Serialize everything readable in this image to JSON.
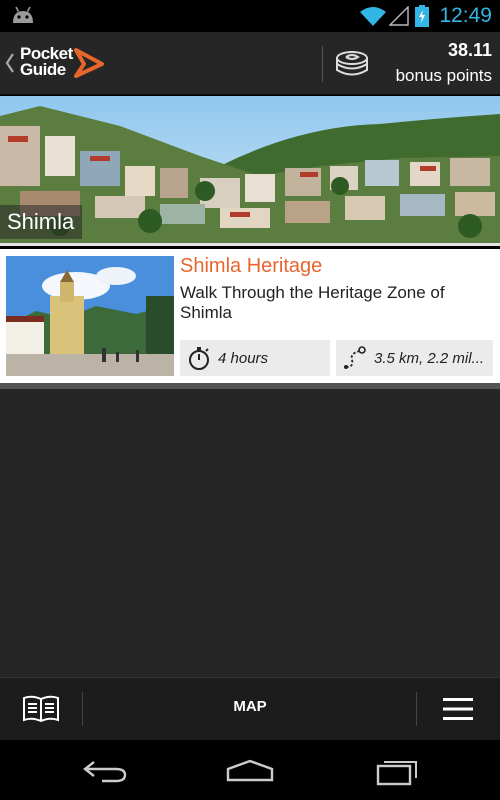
{
  "status_bar": {
    "time": "12:49",
    "icons": [
      "android-icon",
      "wifi-icon",
      "signal-icon",
      "battery-charging-icon"
    ],
    "time_color": "#33b5e5"
  },
  "header": {
    "logo_line1": "Pocket",
    "logo_line2": "Guide",
    "points_value": "38.11",
    "points_label": "bonus points",
    "accent_color": "#e8652c"
  },
  "hero": {
    "city": "Shimla"
  },
  "tour": {
    "title": "Shimla Heritage",
    "description": "Walk Through the Heritage Zone of Shimla",
    "duration": "4 hours",
    "distance": "3.5 km, 2.2 mil..."
  },
  "bottom_bar": {
    "map_label": "MAP",
    "icons": [
      "guide-book-icon",
      "menu-icon"
    ]
  },
  "nav_bar": {
    "icons": [
      "back-icon",
      "home-icon",
      "recent-apps-icon"
    ]
  }
}
